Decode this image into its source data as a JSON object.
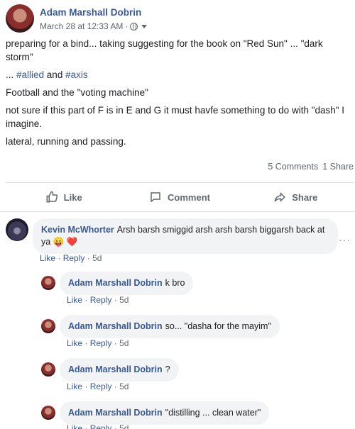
{
  "post": {
    "author": "Adam Marshall Dobrin",
    "timestamp": "March 28 at 12:33 AM",
    "privacy_icon": "globe-icon",
    "lines": {
      "p1": "preparing for a bind... taking suggesting for the book on \"Red Sun\" ... \"dark storm\"",
      "p2_prefix": "... ",
      "p2_tag1": "#allied",
      "p2_mid": " and ",
      "p2_tag2": "#axis",
      "p3": "Football and the \"voting machine\"",
      "p4": "not sure if this part of F is in E and G it must havfe something to do with \"dash\" I imagine.",
      "p5": "lateral, running and passing."
    },
    "comments_count": "5 Comments",
    "shares_count": "1 Share"
  },
  "actions": {
    "like": "Like",
    "comment": "Comment",
    "share": "Share"
  },
  "comments": [
    {
      "author": "Kevin McWhorter",
      "text": "Arsh barsh smiggid arsh arsh barsh biggarsh back at ya",
      "emoji": "😛 ❤️",
      "like": "Like",
      "reply": "Reply",
      "time": "5d"
    }
  ],
  "replies": [
    {
      "author": "Adam Marshall Dobrin",
      "text": "k bro",
      "like": "Like",
      "reply": "Reply",
      "time": "5d"
    },
    {
      "author": "Adam Marshall Dobrin",
      "text": "so... \"dasha for the mayim\"",
      "like": "Like",
      "reply": "Reply",
      "time": "5d"
    },
    {
      "author": "Adam Marshall Dobrin",
      "text": "?",
      "like": "Like",
      "reply": "Reply",
      "time": "5d"
    },
    {
      "author": "Adam Marshall Dobrin",
      "text": "\"distilling ... clean water\"",
      "like": "Like",
      "reply": "Reply",
      "time": "5d"
    }
  ],
  "more_options": "···",
  "separator": "·",
  "colors": {
    "link": "#385898",
    "muted": "#616770",
    "bubble": "#f2f3f5",
    "divider": "#dadde1"
  }
}
